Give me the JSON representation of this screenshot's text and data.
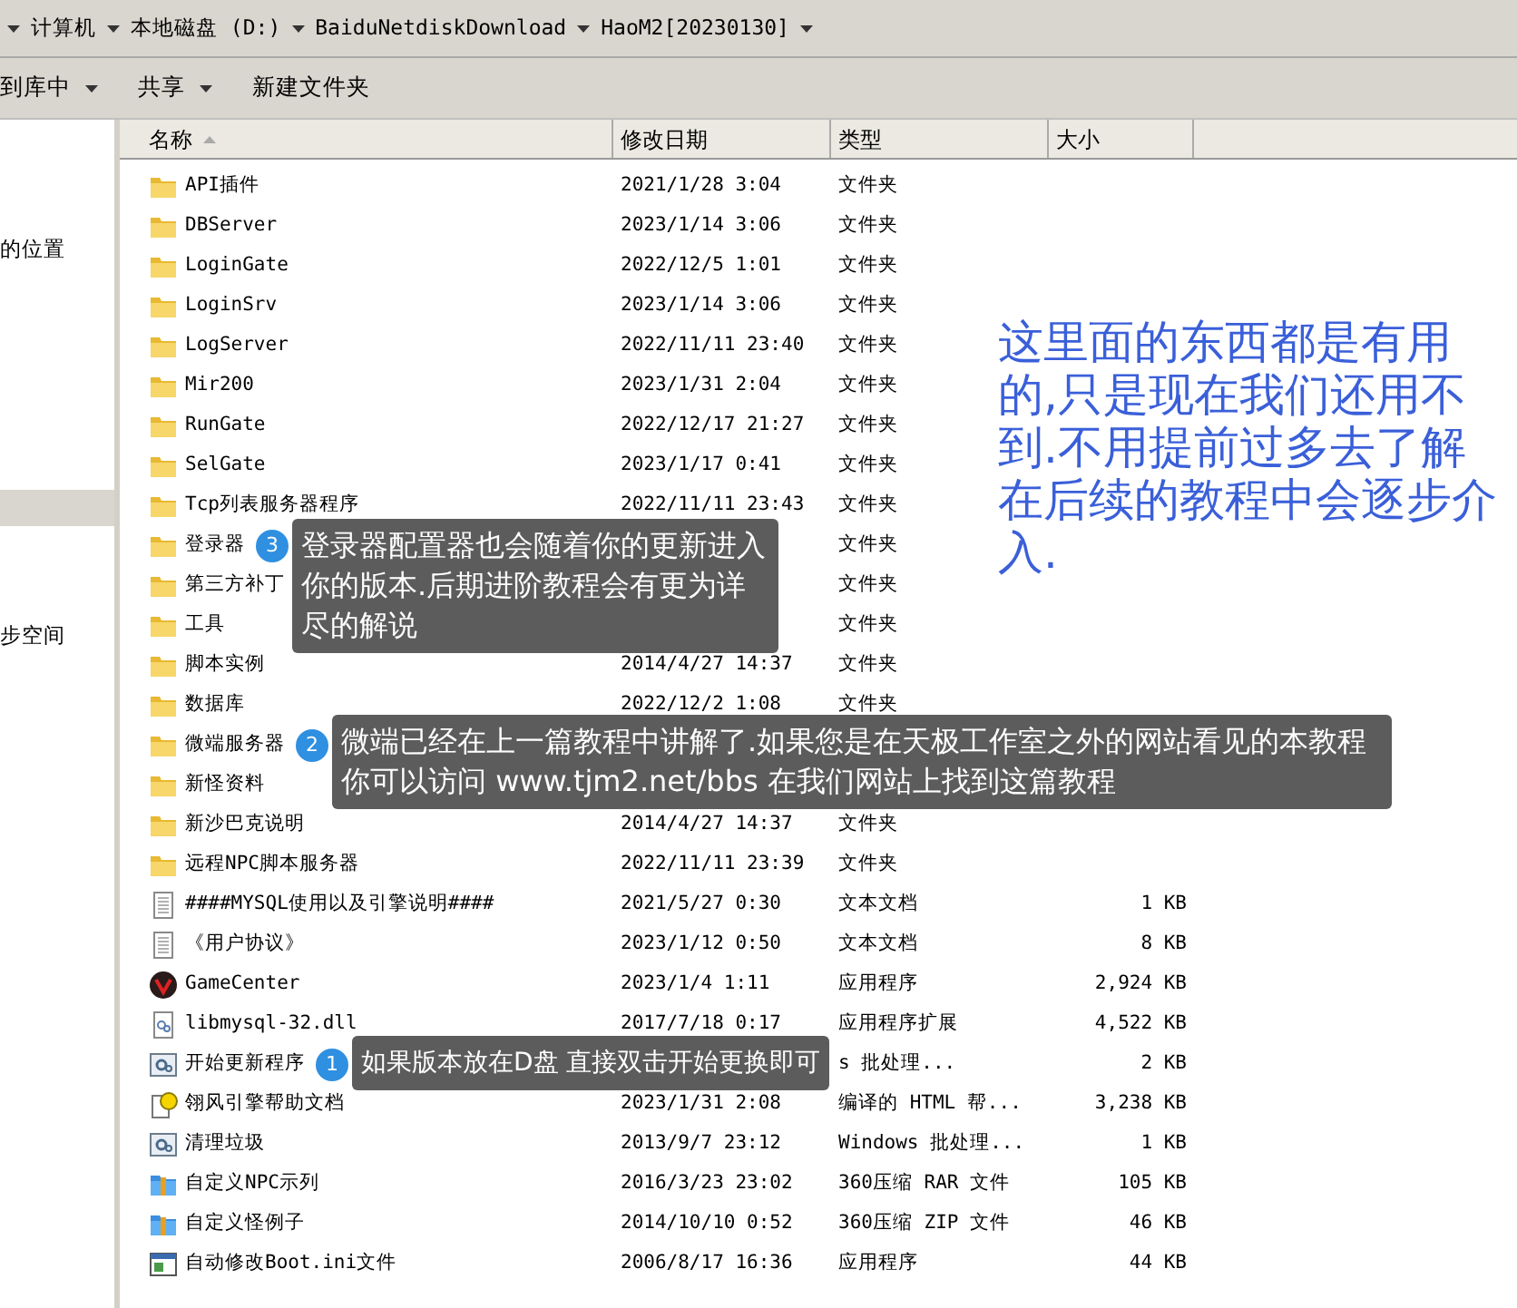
{
  "address_bar": {
    "segments": [
      "计算机",
      "本地磁盘 (D:)",
      "BaiduNetdiskDownload",
      "HaoM2[20230130]"
    ]
  },
  "toolbar": {
    "buttons": [
      {
        "label": "到库中",
        "dropdown": true
      },
      {
        "label": "共享",
        "dropdown": true
      },
      {
        "label": "新建文件夹",
        "dropdown": false
      }
    ]
  },
  "sidebar": {
    "items": [
      {
        "label": "的位置",
        "selected": false
      },
      {
        "selected": true
      },
      {
        "label": "步空间",
        "selected": false
      }
    ]
  },
  "table": {
    "columns": [
      "名称",
      "修改日期",
      "类型",
      "大小"
    ],
    "rows": [
      {
        "kind": "folder",
        "name": "API插件",
        "date": "2021/1/28 3:04",
        "type": "文件夹"
      },
      {
        "kind": "folder",
        "name": "DBServer",
        "date": "2023/1/14 3:06",
        "type": "文件夹"
      },
      {
        "kind": "folder",
        "name": "LoginGate",
        "date": "2022/12/5 1:01",
        "type": "文件夹"
      },
      {
        "kind": "folder",
        "name": "LoginSrv",
        "date": "2023/1/14 3:06",
        "type": "文件夹"
      },
      {
        "kind": "folder",
        "name": "LogServer",
        "date": "2022/11/11 23:40",
        "type": "文件夹"
      },
      {
        "kind": "folder",
        "name": "Mir200",
        "date": "2023/1/31 2:04",
        "type": "文件夹"
      },
      {
        "kind": "folder",
        "name": "RunGate",
        "date": "2022/12/17 21:27",
        "type": "文件夹"
      },
      {
        "kind": "folder",
        "name": "SelGate",
        "date": "2023/1/17 0:41",
        "type": "文件夹"
      },
      {
        "kind": "folder",
        "name": "Tcp列表服务器程序",
        "date": "2022/11/11 23:43",
        "type": "文件夹"
      },
      {
        "kind": "folder",
        "name": "登录器",
        "type": "文件夹",
        "callout": {
          "number": "3",
          "text": "登录器配置器也会随着你的更新进入你的版本.后期进阶教程会有更为详尽的解说"
        }
      },
      {
        "kind": "folder",
        "name": "第三方补丁",
        "type": "文件夹"
      },
      {
        "kind": "folder",
        "name": "工具",
        "type": "文件夹"
      },
      {
        "kind": "folder",
        "name": "脚本实例",
        "date": "2014/4/27 14:37",
        "type": "文件夹"
      },
      {
        "kind": "folder",
        "name": "数据库",
        "date": "2022/12/2 1:08",
        "type": "文件夹"
      },
      {
        "kind": "folder",
        "name": "微端服务器",
        "callout": {
          "number": "2",
          "text": "微端已经在上一篇教程中讲解了.如果您是在天极工作室之外的网站看见的本教程你可以访问 www.tjm2.net/bbs  在我们网站上找到这篇教程"
        }
      },
      {
        "kind": "folder",
        "name": "新怪资料"
      },
      {
        "kind": "folder",
        "name": "新沙巴克说明",
        "date": "2014/4/27 14:37",
        "type": "文件夹"
      },
      {
        "kind": "folder",
        "name": "远程NPC脚本服务器",
        "date": "2022/11/11 23:39",
        "type": "文件夹"
      },
      {
        "kind": "text",
        "name": "####MYSQL使用以及引擎说明####",
        "date": "2021/5/27 0:30",
        "type": "文本文档",
        "size": "1 KB"
      },
      {
        "kind": "text",
        "name": "《用户协议》",
        "date": "2023/1/12 0:50",
        "type": "文本文档",
        "size": "8 KB"
      },
      {
        "kind": "gamecenter",
        "name": "GameCenter",
        "date": "2023/1/4 1:11",
        "type": "应用程序",
        "size": "2,924 KB"
      },
      {
        "kind": "dll",
        "name": "libmysql-32.dll",
        "date": "2017/7/18 0:17",
        "type": "应用程序扩展",
        "size": "4,522 KB"
      },
      {
        "kind": "batch",
        "name": "开始更新程序",
        "type": "s 批处理...",
        "size": "2 KB",
        "callout": {
          "number": "1",
          "text": "如果版本放在D盘 直接双击开始更换即可"
        }
      },
      {
        "kind": "help",
        "name": "翎风引擎帮助文档",
        "date": "2023/1/31 2:08",
        "type": "编译的 HTML 帮...",
        "size": "3,238 KB"
      },
      {
        "kind": "batch",
        "name": "清理垃圾",
        "date": "2013/9/7 23:12",
        "type": "Windows 批处理...",
        "size": "1 KB"
      },
      {
        "kind": "archive",
        "name": "自定义NPC示列",
        "date": "2016/3/23 23:02",
        "type": "360压缩 RAR 文件",
        "size": "105 KB"
      },
      {
        "kind": "archive",
        "name": "自定义怪例子",
        "date": "2014/10/10 0:52",
        "type": "360压缩 ZIP 文件",
        "size": "46 KB"
      },
      {
        "kind": "program",
        "name": "自动修改Boot.ini文件",
        "date": "2006/8/17 16:36",
        "type": "应用程序",
        "size": "44 KB"
      }
    ]
  },
  "note": "这里面的东西都是有用的,只是现在我们还用不到.不用提前过多去了解在后续的教程中会逐步介入."
}
